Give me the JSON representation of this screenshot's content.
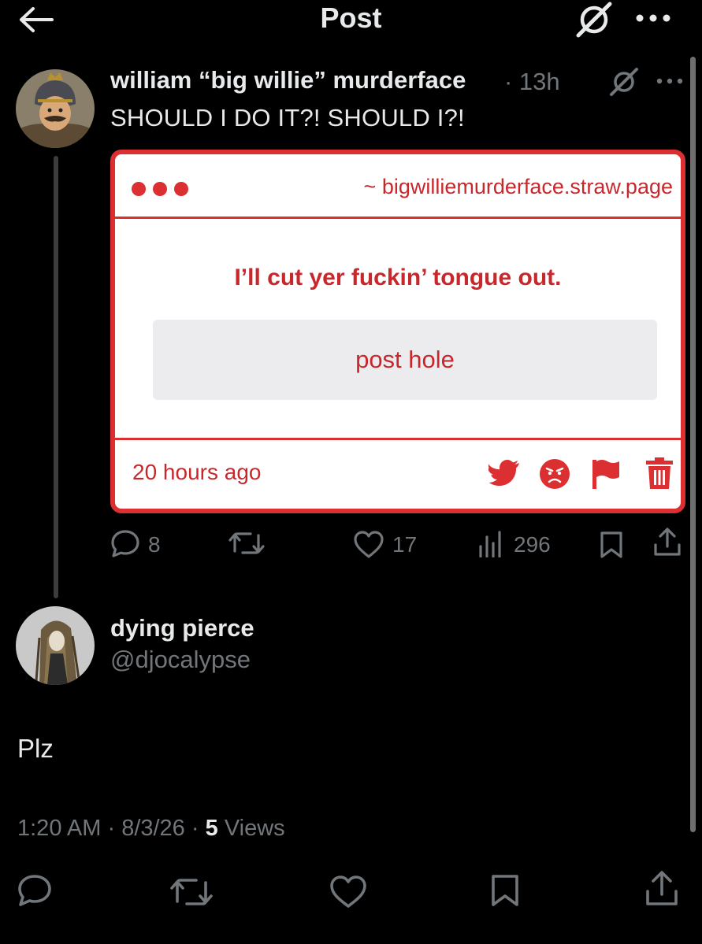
{
  "header": {
    "title": "Post"
  },
  "post": {
    "author_name": "william “big willie” murderface",
    "time": "· 13h",
    "text": "SHOULD I DO IT?! SHOULD I?!",
    "card": {
      "url": "~ bigwilliemurderface.straw.page",
      "message": "I’ll cut yer fuckin’ tongue out.",
      "button_label": "post hole",
      "timestamp": "20 hours ago",
      "accent_color": "#dc2f32"
    },
    "actions": {
      "replies": "8",
      "likes": "17",
      "views": "296"
    }
  },
  "reply": {
    "author_name": "dying pierce",
    "handle": "@djocalypse",
    "text": "Plz",
    "time": "1:20 AM",
    "date": "8/3/26",
    "views_count": "5",
    "views_label": "Views"
  },
  "icons": {
    "back": "arrow-left-icon",
    "grok": "grok-icon",
    "more": "more-horizontal-icon",
    "reply": "reply-icon",
    "repost": "repost-icon",
    "like": "heart-icon",
    "views": "views-icon",
    "bookmark": "bookmark-icon",
    "share": "share-icon"
  },
  "colors": {
    "background": "#000000",
    "text_primary": "#e7e9ea",
    "text_secondary": "#71767b",
    "card_red": "#c8282c"
  }
}
